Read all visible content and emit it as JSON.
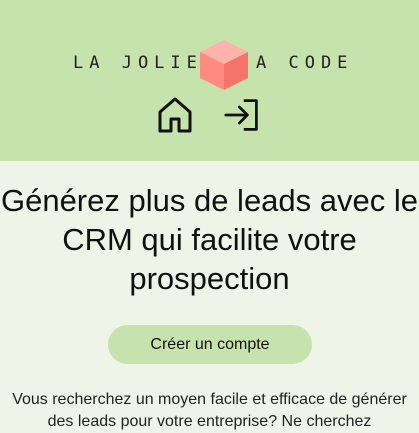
{
  "header": {
    "logo_left": "LA JOLIE",
    "logo_right": "A CODE",
    "icons": [
      "home-icon",
      "login-icon"
    ]
  },
  "hero": {
    "title": "Générez plus de leads avec le CRM qui facilite votre prospection"
  },
  "cta": {
    "label": "Créer un compte"
  },
  "intro": {
    "text": "Vous recherchez un moyen facile et efficace de générer des leads pour votre entreprise? Ne cherchez"
  },
  "colors": {
    "header_bg": "#c6e2ad",
    "page_bg": "#eef5e8",
    "cube": "#ff8a80"
  }
}
